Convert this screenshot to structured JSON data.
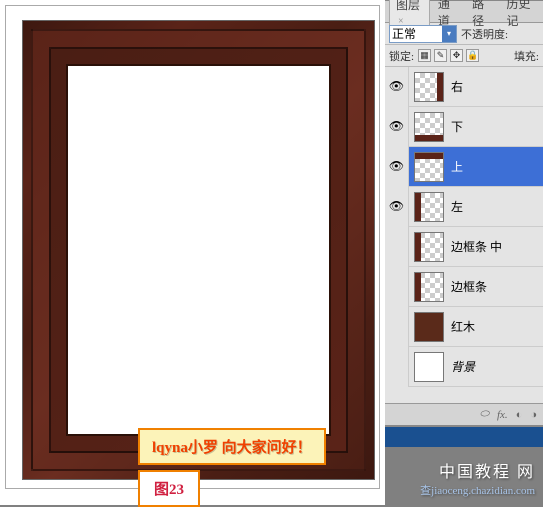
{
  "canvas": {
    "caption1": "lqyna小罗 向大家问好！",
    "caption2": "图23"
  },
  "panel": {
    "tabs": {
      "layers": "图层",
      "channels": "通道",
      "paths": "路径",
      "history": "历史记"
    },
    "blend_mode": "正常",
    "opacity_label": "不透明度:",
    "lock_label": "锁定:",
    "fill_label": "填充:",
    "layers": [
      {
        "name": "右",
        "visible": true,
        "thumb": "right",
        "selected": false
      },
      {
        "name": "下",
        "visible": true,
        "thumb": "bottom",
        "selected": false
      },
      {
        "name": "上",
        "visible": true,
        "thumb": "top",
        "selected": true
      },
      {
        "name": "左",
        "visible": true,
        "thumb": "left",
        "selected": false
      },
      {
        "name": "边框条 中",
        "visible": false,
        "thumb": "mid",
        "selected": false
      },
      {
        "name": "边框条",
        "visible": false,
        "thumb": "border",
        "selected": false
      },
      {
        "name": "红木",
        "visible": false,
        "thumb": "wood",
        "selected": false
      },
      {
        "name": "背景",
        "visible": false,
        "thumb": "bg",
        "selected": false
      }
    ]
  },
  "watermark": {
    "main": "中国教程 网",
    "sub": "查jiaoceng.chazidian.com"
  }
}
